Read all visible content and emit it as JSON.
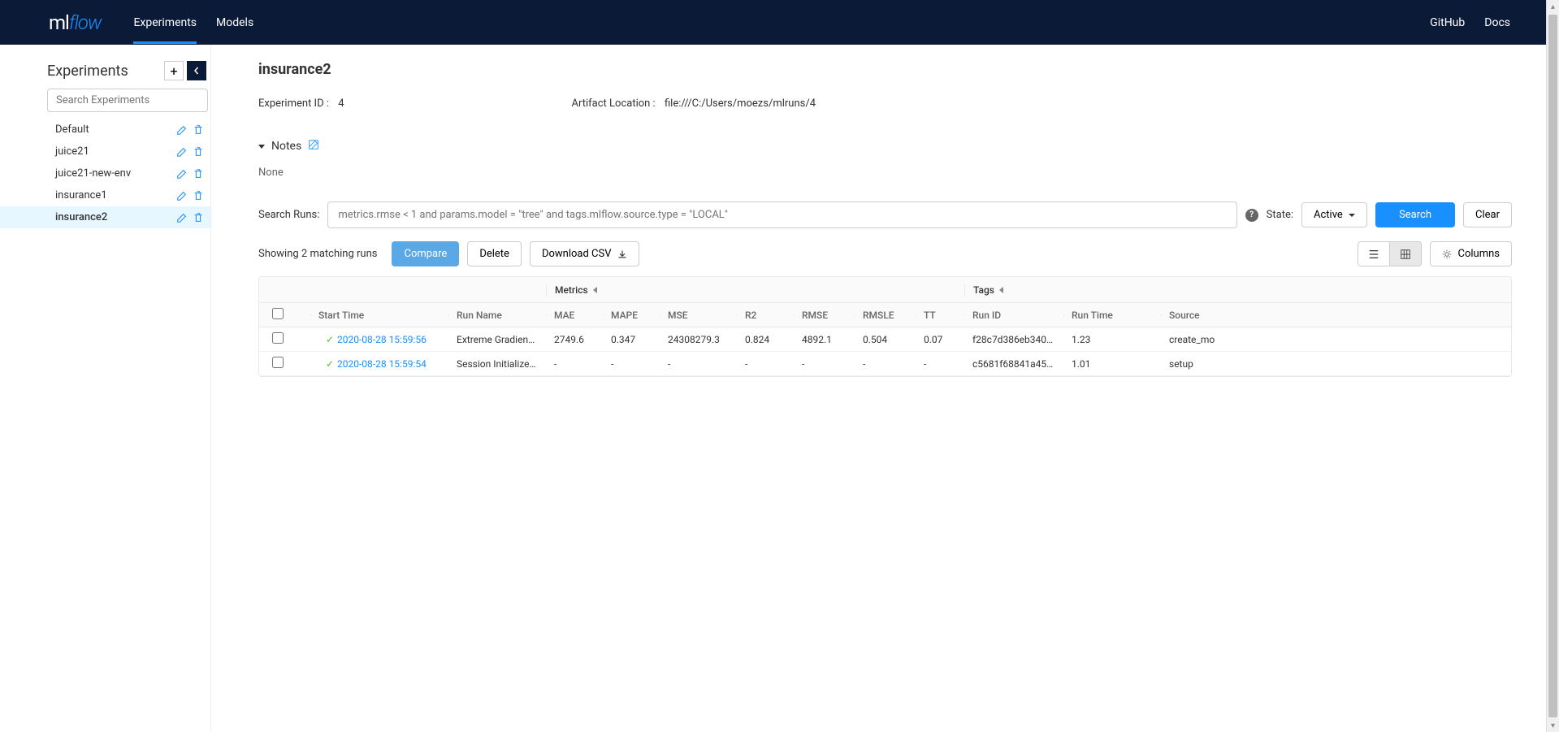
{
  "header": {
    "logo_ml": "ml",
    "logo_flow": "flow",
    "nav": [
      "Experiments",
      "Models"
    ],
    "active_nav": "Experiments",
    "right_nav": [
      "GitHub",
      "Docs"
    ]
  },
  "sidebar": {
    "title": "Experiments",
    "search_placeholder": "Search Experiments",
    "items": [
      {
        "name": "Default",
        "active": false
      },
      {
        "name": "juice21",
        "active": false
      },
      {
        "name": "juice21-new-env",
        "active": false
      },
      {
        "name": "insurance1",
        "active": false
      },
      {
        "name": "insurance2",
        "active": true
      }
    ]
  },
  "experiment": {
    "title": "insurance2",
    "id_label": "Experiment ID :",
    "id_value": "4",
    "artifact_label": "Artifact Location :",
    "artifact_value": "file:///C:/Users/moezs/mlruns/4",
    "notes_label": "Notes",
    "notes_content": "None"
  },
  "search": {
    "label": "Search Runs:",
    "placeholder": "metrics.rmse < 1 and params.model = \"tree\" and tags.mlflow.source.type = \"LOCAL\"",
    "state_label": "State:",
    "state_value": "Active",
    "search_btn": "Search",
    "clear_btn": "Clear"
  },
  "actions": {
    "showing": "Showing 2 matching runs",
    "compare": "Compare",
    "delete": "Delete",
    "download": "Download CSV",
    "columns": "Columns"
  },
  "table": {
    "group_metrics": "Metrics",
    "group_tags": "Tags",
    "headers": {
      "start_time": "Start Time",
      "run_name": "Run Name",
      "mae": "MAE",
      "mape": "MAPE",
      "mse": "MSE",
      "r2": "R2",
      "rmse": "RMSE",
      "rmsle": "RMSLE",
      "tt": "TT",
      "run_id": "Run ID",
      "run_time": "Run Time",
      "source": "Source"
    },
    "rows": [
      {
        "start_time": "2020-08-28 15:59:56",
        "run_name": "Extreme Gradient ...",
        "mae": "2749.6",
        "mape": "0.347",
        "mse": "24308279.3",
        "r2": "0.824",
        "rmse": "4892.1",
        "rmsle": "0.504",
        "tt": "0.07",
        "run_id": "f28c7d386eb3405...",
        "run_time": "1.23",
        "source": "create_mo"
      },
      {
        "start_time": "2020-08-28 15:59:54",
        "run_name": "Session Initialized ...",
        "mae": "-",
        "mape": "-",
        "mse": "-",
        "r2": "-",
        "rmse": "-",
        "rmsle": "-",
        "tt": "-",
        "run_id": "c5681f68841a459...",
        "run_time": "1.01",
        "source": "setup"
      }
    ]
  }
}
